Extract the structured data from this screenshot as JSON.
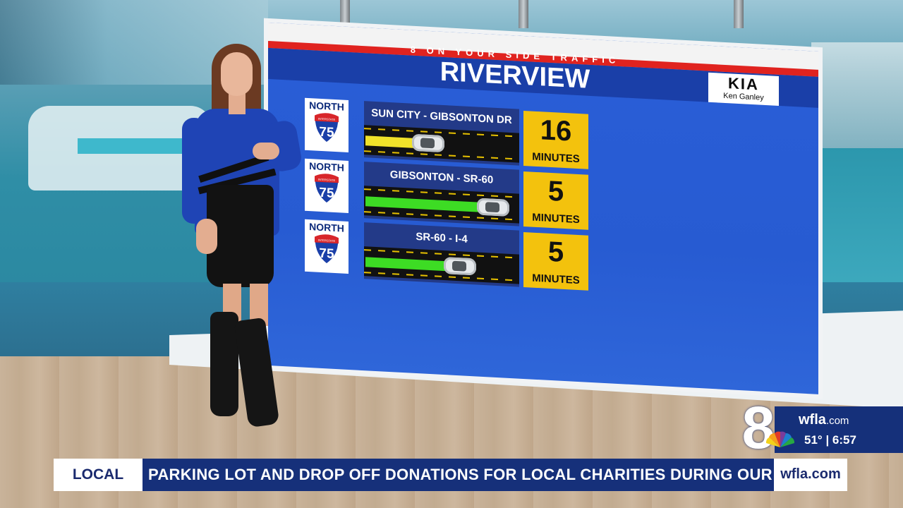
{
  "board": {
    "tagline": "8 ON YOUR SIDE TRAFFIC",
    "title": "RIVERVIEW",
    "sponsor_logo": "KIA",
    "sponsor_name": "Ken Ganley",
    "routes": [
      {
        "direction": "NORTH",
        "shield_number": "75",
        "shield_label": "INTERSTATE",
        "segment": "SUN CITY - GIBSONTON DR",
        "time_value": "16",
        "time_unit": "MINUTES",
        "flow_color": "#f0e22a",
        "flow_fraction": 0.35
      },
      {
        "direction": "NORTH",
        "shield_number": "75",
        "shield_label": "INTERSTATE",
        "segment": "GIBSONTON - SR-60",
        "time_value": "5",
        "time_unit": "MINUTES",
        "flow_color": "#3ddc24",
        "flow_fraction": 0.78
      },
      {
        "direction": "NORTH",
        "shield_number": "75",
        "shield_label": "INTERSTATE",
        "segment": "SR-60 - I-4",
        "time_value": "5",
        "time_unit": "MINUTES",
        "flow_color": "#3ddc24",
        "flow_fraction": 0.56
      }
    ]
  },
  "lower_third": {
    "category": "LOCAL",
    "ticker": "PARKING LOT AND DROP OFF DONATIONS FOR LOCAL CHARITIES DURING OUR ANN",
    "brand": "wfla.com"
  },
  "bug": {
    "channel": "8",
    "site_name": "wfla",
    "site_suffix": ".com",
    "temperature": "51°",
    "time": "6:57"
  },
  "colors": {
    "board_blue": "#2a5ed7",
    "header_red": "#e0231f",
    "time_yellow": "#f3c20d",
    "brand_navy": "#16307a"
  }
}
